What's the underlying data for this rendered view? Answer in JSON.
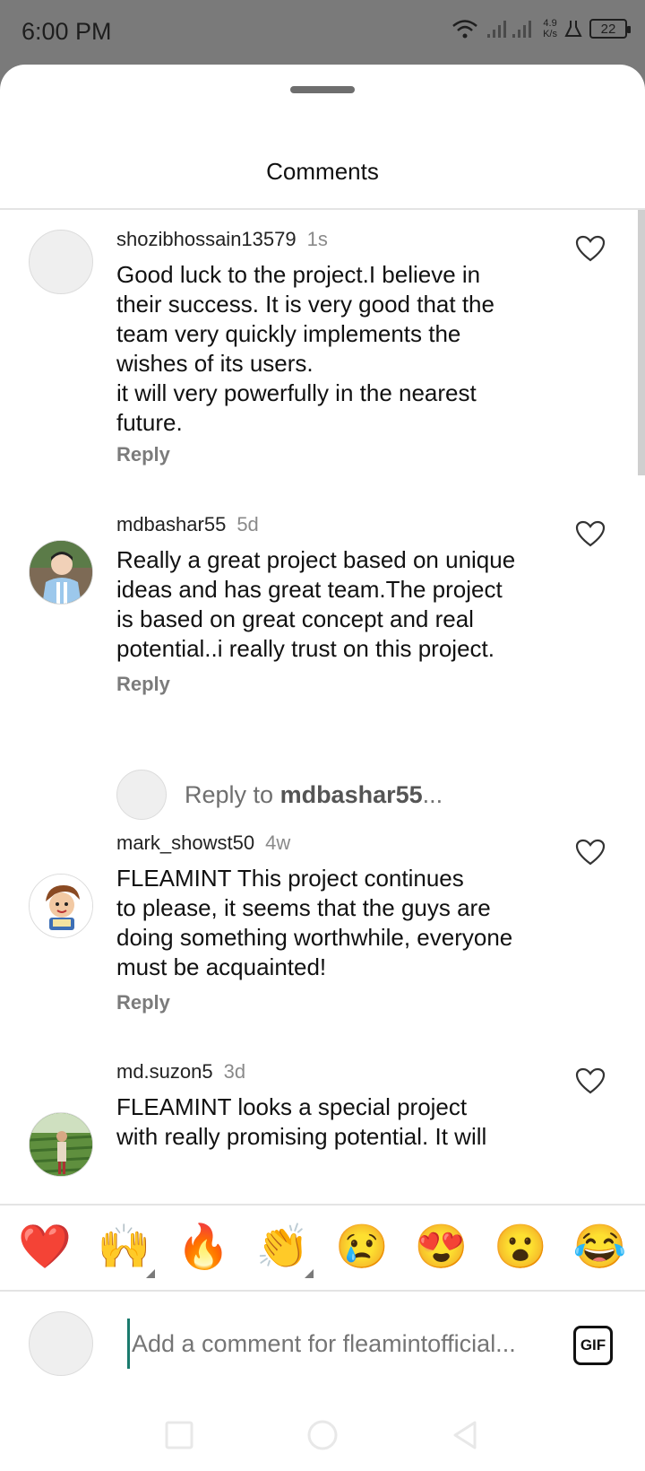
{
  "status_bar": {
    "time": "6:00 PM",
    "net_speed_value": "4.9",
    "net_speed_unit": "K/s",
    "battery": "22"
  },
  "sheet": {
    "title": "Comments"
  },
  "comments": [
    {
      "username": "shozibhossain13579",
      "time": "1s",
      "text": "Good luck to the project.I believe in\ntheir success. It is very good that the\nteam very quickly implements the\nwishes of its users.\nit will very powerfully in the nearest\nfuture.",
      "reply_label": "Reply"
    },
    {
      "username": "mdbashar55",
      "time": "5d",
      "text": "Really a great project based on unique\nideas and has great team.The project\nis based on great concept and real\npotential..i really trust on this project.",
      "reply_label": "Reply"
    },
    {
      "username": "mark_showst50",
      "time": "4w",
      "text": "FLEAMINT This project continues\nto please, it seems that the guys are\ndoing something worthwhile, everyone\nmust be acquainted!",
      "reply_label": "Reply"
    },
    {
      "username": "md.suzon5",
      "time": "3d",
      "text": "FLEAMINT looks a special project\nwith really promising potential. It will",
      "reply_label": ""
    }
  ],
  "reply_prompt": {
    "prefix": "Reply to ",
    "username": "mdbashar55",
    "suffix": "..."
  },
  "emojis": [
    "❤️",
    "🙌",
    "🔥",
    "👏",
    "😢",
    "😍",
    "😮",
    "😂"
  ],
  "composer": {
    "placeholder": "Add a comment for fleamintofficial...",
    "gif_label": "GIF"
  },
  "colors": {
    "accent_cursor": "#1a7a6d",
    "background_dim": "#7a7a7a"
  }
}
